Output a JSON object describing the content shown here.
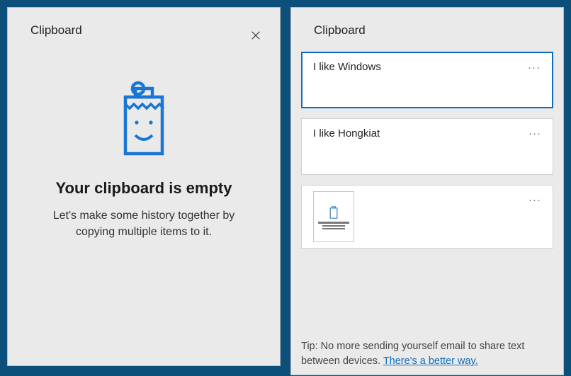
{
  "left": {
    "title": "Clipboard",
    "empty_heading": "Your clipboard is empty",
    "empty_sub": "Let's make some history together by copying multiple items to it."
  },
  "right": {
    "title": "Clipboard",
    "items": [
      {
        "text": "I like Windows",
        "selected": true,
        "kind": "text"
      },
      {
        "text": "I like Hongkiat",
        "selected": false,
        "kind": "text"
      },
      {
        "text": "",
        "selected": false,
        "kind": "image"
      }
    ],
    "tip_prefix": "Tip: No more sending yourself email to share text between devices.  ",
    "tip_link": "There's a better way."
  },
  "colors": {
    "accent": "#0f6cbd",
    "icon_blue": "#1976d2"
  }
}
